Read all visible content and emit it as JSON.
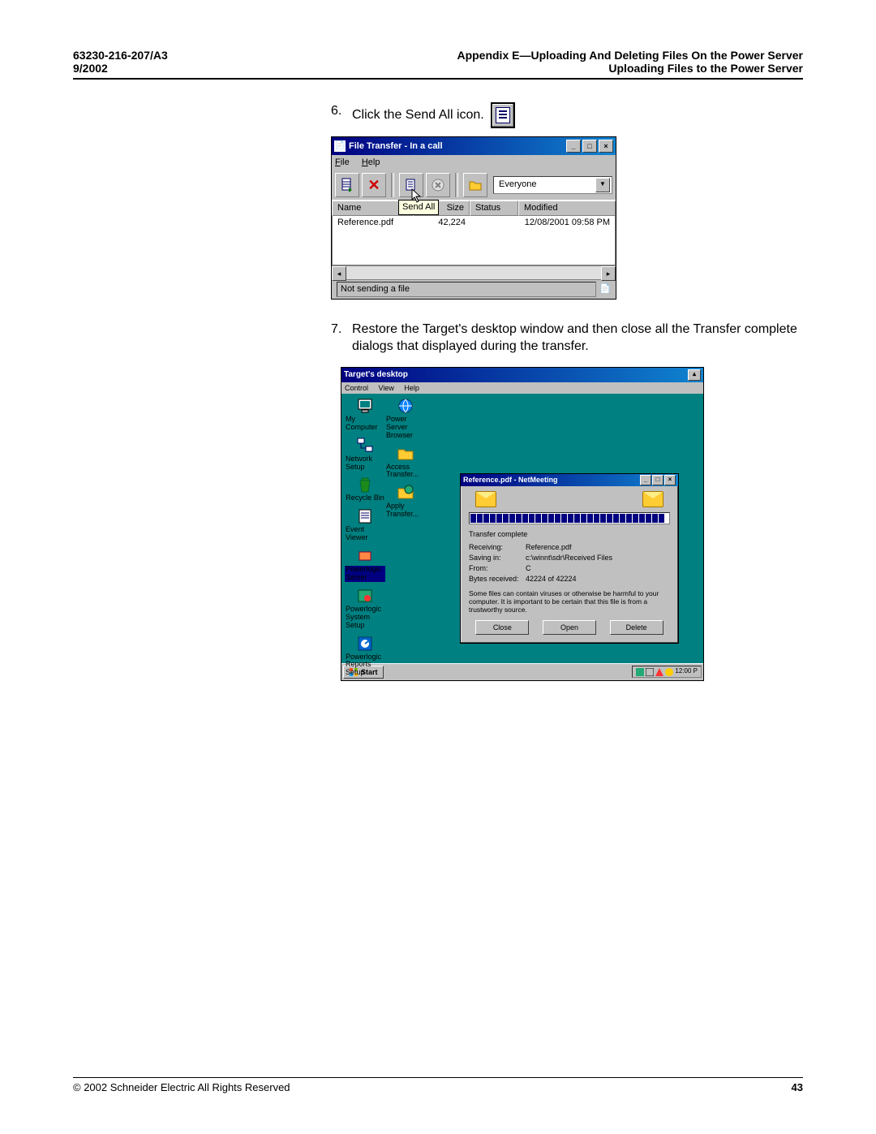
{
  "header": {
    "doc_number": "63230-216-207/A3",
    "doc_date": "9/2002",
    "appendix": "Appendix E—Uploading And Deleting Files On the Power Server",
    "section": "Uploading Files to the Power Server"
  },
  "steps": {
    "s6": {
      "num": "6.",
      "text": "Click the Send All icon."
    },
    "s7": {
      "num": "7.",
      "text": "Restore the Target's desktop window and then close all the Transfer complete dialogs that displayed during the transfer."
    }
  },
  "file_transfer": {
    "title": "File Transfer - In a call",
    "menu_file": "File",
    "menu_help": "Help",
    "tooltip": "Send All",
    "dropdown_value": "Everyone",
    "col_name": "Name",
    "col_size": "Size",
    "col_status": "Status",
    "col_modified": "Modified",
    "row": {
      "name": "Reference.pdf",
      "size": "42,224",
      "status": "",
      "modified": "12/08/2001  09:58 PM"
    },
    "status_text": "Not sending a file"
  },
  "target": {
    "title": "Target's desktop",
    "menu_control": "Control",
    "menu_view": "View",
    "menu_help": "Help",
    "icons": {
      "my_computer": "My Computer",
      "power_server_browser": "Power Server Browser",
      "network_setup": "Network Setup",
      "access_transfer": "Access Transfer...",
      "recycle_bin": "Recycle Bin",
      "apply_transfer": "Apply Transfer...",
      "event_viewer": "Event Viewer",
      "powerlogic_server": "Powerlogic Server",
      "powerlogic_system_setup": "Powerlogic System Setup",
      "powerlogic_reports_setup": "Powerlogic Reports Setup"
    },
    "netmeeting": {
      "title": "Reference.pdf - NetMeeting",
      "transfer_complete": "Transfer complete",
      "receiving_k": "Receiving:",
      "receiving_v": "Reference.pdf",
      "saving_k": "Saving in:",
      "saving_v": "c:\\winnt\\sdr\\Received Files",
      "from_k": "From:",
      "from_v": "C",
      "bytes_k": "Bytes received:",
      "bytes_v": "42224 of 42224",
      "warning": "Some files can contain viruses or otherwise be harmful to your computer. It is important to be certain that this file is from a trustworthy source.",
      "btn_close": "Close",
      "btn_open": "Open",
      "btn_delete": "Delete"
    },
    "start_label": "Start",
    "clock": "12:00 P"
  },
  "footer": {
    "copyright": "© 2002 Schneider Electric  All Rights Reserved",
    "page": "43"
  }
}
